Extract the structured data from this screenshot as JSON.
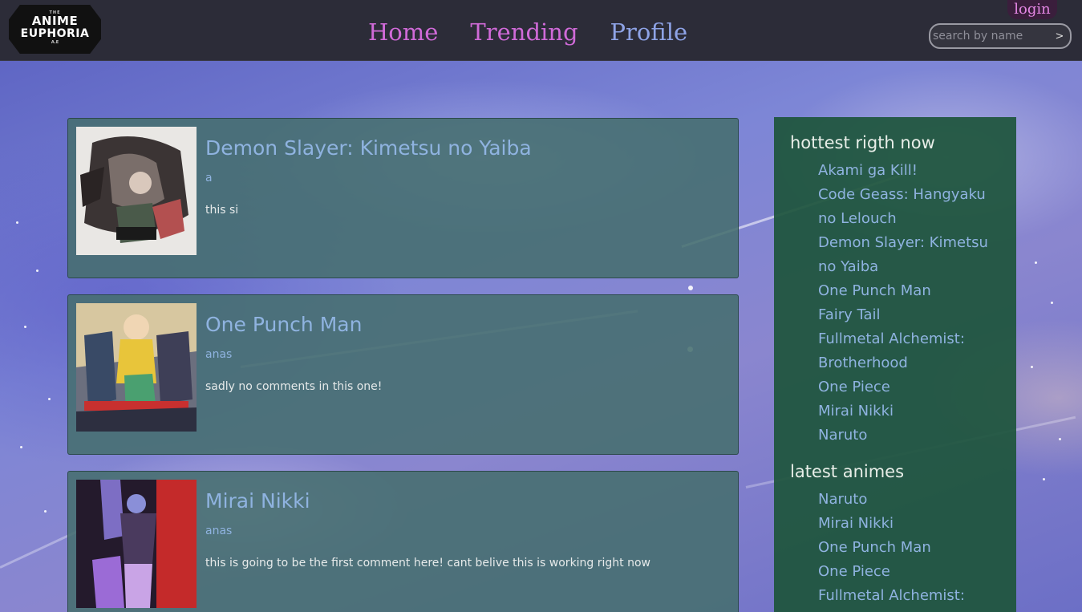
{
  "logo": {
    "top": "THE",
    "line1": "ANIME",
    "line2": "EUPHORIA",
    "bottom": "A.E"
  },
  "nav": {
    "home": "Home",
    "trending": "Trending",
    "profile": "Profile"
  },
  "login": "login",
  "search": {
    "placeholder": "search by name",
    "value": "",
    "submit": ">"
  },
  "posts": [
    {
      "title": "Demon Slayer: Kimetsu no Yaiba",
      "author": "a",
      "comment": "this si"
    },
    {
      "title": "One Punch Man",
      "author": "anas",
      "comment": "sadly no comments in this one!"
    },
    {
      "title": "Mirai Nikki",
      "author": "anas",
      "comment": "this is going to be the first comment here! cant belive this is working right now"
    }
  ],
  "sidebar": {
    "hottest_title": "hottest rigth now",
    "hottest": [
      "Akami ga Kill!",
      "Code Geass: Hangyaku",
      "no Lelouch",
      "Demon Slayer: Kimetsu",
      "no Yaiba",
      "One Punch Man",
      "Fairy Tail",
      "Fullmetal Alchemist:",
      "Brotherhood",
      "One Piece",
      "Mirai Nikki",
      "Naruto"
    ],
    "latest_title": "latest animes",
    "latest": [
      "Naruto",
      "Mirai Nikki",
      "One Punch Man",
      "One Piece",
      "Fullmetal Alchemist:"
    ]
  }
}
